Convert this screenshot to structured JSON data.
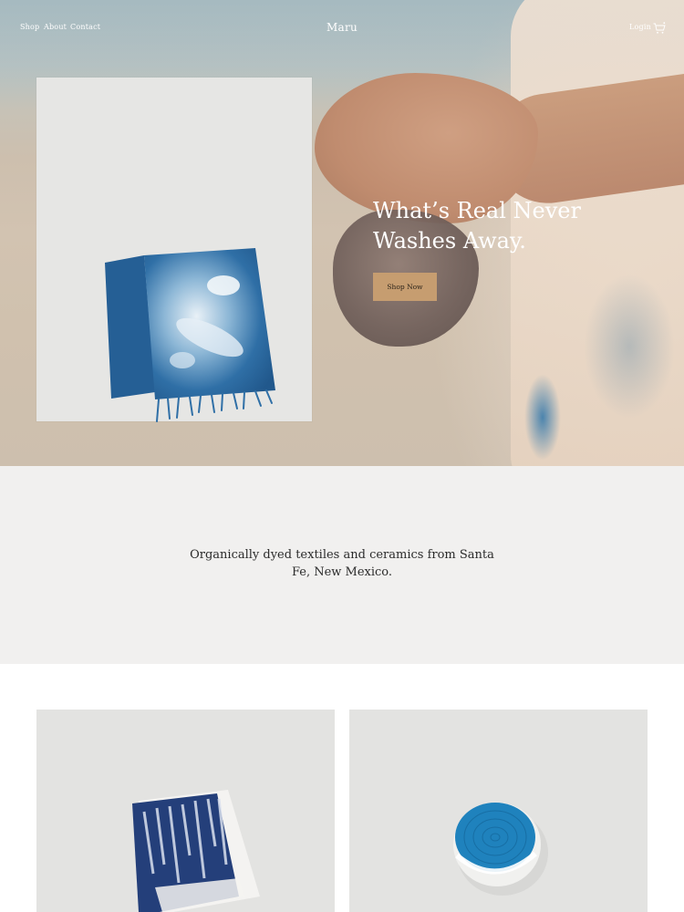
{
  "nav": {
    "links": [
      "Shop",
      "About",
      "Contact"
    ],
    "brand": "Maru",
    "login": "Login",
    "cart_icon": "cart-icon"
  },
  "hero": {
    "headline": "What’s Real Never Washes Away.",
    "cta_label": "Shop Now",
    "cta_color": "#c69d70"
  },
  "intro": {
    "text": "Organically dyed textiles and ceramics from Santa Fe, New Mexico."
  },
  "colors": {
    "indigo": "#2f6fa6",
    "intro_bg": "#f1f0ef",
    "panel_bg": "#e6e6e4"
  }
}
